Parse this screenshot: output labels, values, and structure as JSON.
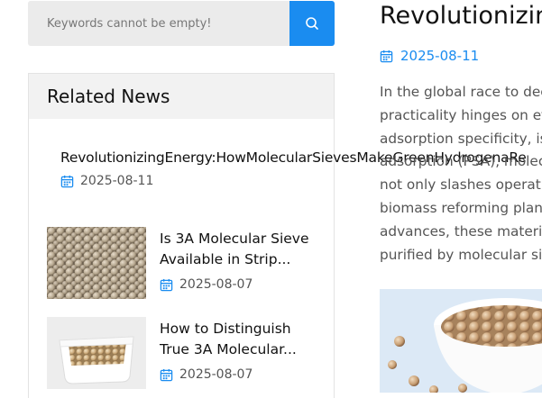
{
  "search": {
    "placeholder": "Keywords cannot be empty!"
  },
  "related": {
    "heading": "Related News",
    "featured": {
      "title": "RevolutionizingEnergy:HowMolecularSievesMakeGreenHydrogenaRe",
      "date": "2025-08-11"
    },
    "items": [
      {
        "title": "Is 3A Molecular Sieve Available in Strip...",
        "date": "2025-08-07"
      },
      {
        "title": "How to Distinguish True 3A Molecular...",
        "date": "2025-08-07"
      }
    ]
  },
  "article": {
    "title": "Revolutionizing Energy",
    "date": "2025-08-11",
    "lines": [
      "In the global race to decarbonize",
      "practicality hinges on efficient",
      "adsorption specificity, is",
      "adsorption (PSA), molecular",
      "not only slashes operating",
      "biomass reforming plants",
      "advances, these materials",
      "purified by molecular sieves"
    ]
  },
  "colors": {
    "accent": "#1a8cf0",
    "panel_header": "#f2f2f2",
    "search_bg": "#ebebeb"
  },
  "icons": {
    "search": "search-icon",
    "date": "calendar-icon"
  }
}
